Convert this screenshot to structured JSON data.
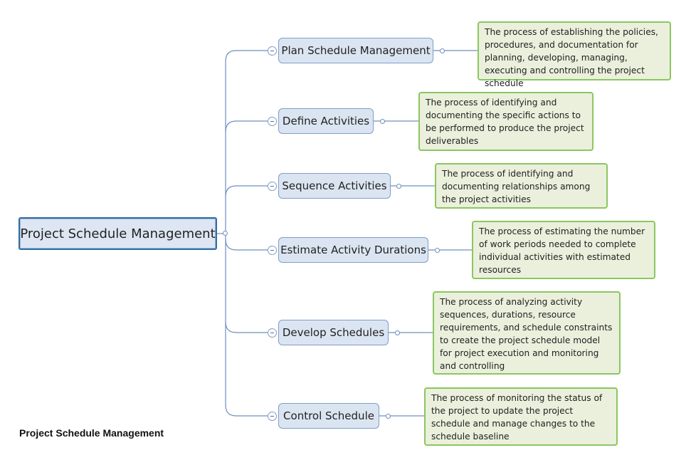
{
  "root": {
    "label": "Project Schedule Management"
  },
  "caption": "Project Schedule Management",
  "colors": {
    "root_border": "#2f6fa8",
    "topic_fill": "#dbe5f2",
    "topic_border": "#7f9ec9",
    "note_fill": "#eaf0dc",
    "note_border": "#8cc660",
    "connector": "#6f8fbf"
  },
  "topics": [
    {
      "label": "Plan Schedule Management",
      "note": "The process of establishing the policies, procedures, and documentation for planning, developing, managing, executing and controlling the project schedule"
    },
    {
      "label": "Define Activities",
      "note": "The process of identifying and documenting the specific actions to be performed to produce the project deliverables"
    },
    {
      "label": "Sequence Activities",
      "note": "The process of identifying and documenting relationships among the project activities"
    },
    {
      "label": "Estimate Activity Durations",
      "note": "The process of estimating the number of work periods needed to complete individual activities with estimated resources"
    },
    {
      "label": "Develop Schedules",
      "note": "The process of analyzing activity sequences, durations, resource requirements, and schedule constraints to create the project schedule model for project execution and monitoring and controlling"
    },
    {
      "label": "Control Schedule",
      "note": "The process of monitoring the status of the project to update the project schedule and manage changes to the schedule baseline"
    }
  ]
}
